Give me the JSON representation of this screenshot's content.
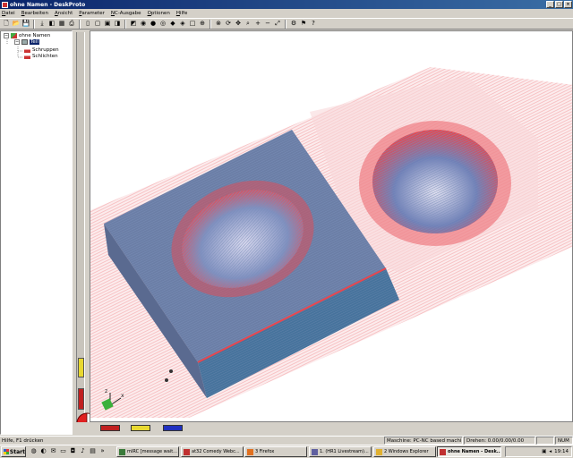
{
  "window": {
    "title": "ohne Namen - DeskProto",
    "min_label": "_",
    "max_label": "□",
    "close_label": "×"
  },
  "menu": [
    "Datei",
    "Bearbeiten",
    "Ansicht",
    "Parameter",
    "NC-Ausgabe",
    "Optionen",
    "Hilfe"
  ],
  "toolbar": {
    "buttons": [
      {
        "icon": "new-icon",
        "glyph": "🗋"
      },
      {
        "icon": "open-icon",
        "glyph": "📂"
      },
      {
        "icon": "save-icon",
        "glyph": "💾"
      },
      {
        "icon": "import-icon",
        "glyph": "⤓"
      },
      {
        "icon": "model-icon",
        "glyph": "◧"
      },
      {
        "icon": "toolpath-icon",
        "glyph": "▦"
      },
      {
        "icon": "print-icon",
        "glyph": "⎙"
      },
      {
        "icon": "doc-icon",
        "glyph": "▯"
      },
      {
        "icon": "view-top-icon",
        "glyph": "▢"
      },
      {
        "icon": "view-front-icon",
        "glyph": "▣"
      },
      {
        "icon": "view-side-icon",
        "glyph": "◨"
      },
      {
        "icon": "view-iso-icon",
        "glyph": "◩"
      },
      {
        "icon": "eye-icon",
        "glyph": "◉"
      },
      {
        "icon": "shade-icon",
        "glyph": "●"
      },
      {
        "icon": "wire-icon",
        "glyph": "◎"
      },
      {
        "icon": "part-icon",
        "glyph": "◆"
      },
      {
        "icon": "layer-icon",
        "glyph": "◈"
      },
      {
        "icon": "box-icon",
        "glyph": "□"
      },
      {
        "icon": "target-icon",
        "glyph": "⊕"
      },
      {
        "icon": "axis-icon",
        "glyph": "⊗"
      },
      {
        "icon": "rotate-icon",
        "glyph": "⟳"
      },
      {
        "icon": "pan-icon",
        "glyph": "✥"
      },
      {
        "icon": "zoom-icon",
        "glyph": "⌕"
      },
      {
        "icon": "zoom-in-icon",
        "glyph": "+"
      },
      {
        "icon": "zoom-out-icon",
        "glyph": "−"
      },
      {
        "icon": "fit-icon",
        "glyph": "⤢"
      },
      {
        "icon": "nc-output-icon",
        "glyph": "⚙"
      },
      {
        "icon": "simulate-icon",
        "glyph": "⚑"
      },
      {
        "icon": "help-icon",
        "glyph": "?"
      }
    ]
  },
  "tree": {
    "root": "ohne Namen",
    "part": "Teil",
    "ops": [
      "Schruppen",
      "Schlichten"
    ]
  },
  "colors": {
    "toolpath": "#e8474f",
    "model_top": "#6b7ea6",
    "model_side": "#46739c"
  },
  "statusbar": {
    "help": "Hilfe, F1 drücken",
    "machine": "Maschine: PC-NC based machine",
    "rotation": "Drehen: 0.00/0.00/0.00",
    "mode": "NUM"
  },
  "taskbar": {
    "start": "Start",
    "tasks": [
      {
        "label": "mIRC [message wait...",
        "icon": "mirc-icon",
        "color": "#3a7a3a"
      },
      {
        "label": "at32 Comedy Webc...",
        "icon": "web-icon",
        "color": "#c03030"
      },
      {
        "label": "3 Firefox",
        "icon": "firefox-icon",
        "color": "#e07020"
      },
      {
        "label": "1. (HR1 Livestream)...",
        "icon": "stream-icon",
        "color": "#6060a0"
      },
      {
        "label": "2 Windows Explorer",
        "icon": "explorer-icon",
        "color": "#e0b030"
      },
      {
        "label": "ohne Namen - Desk...",
        "icon": "deskproto-icon",
        "color": "#c03030"
      }
    ],
    "clock": "19:14"
  }
}
